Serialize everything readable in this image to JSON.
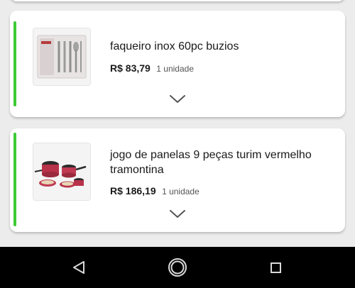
{
  "products": [
    {
      "title": "faqueiro inox 60pc buzios",
      "price": "R$ 83,79",
      "quantity": "1 unidade",
      "thumbnail_icon": "cutlery-set-box-image",
      "expand_icon": "chevron-down-icon"
    },
    {
      "title": "jogo de panelas 9 peças turim vermelho tramontina",
      "price": "R$ 186,19",
      "quantity": "1 unidade",
      "thumbnail_icon": "cookware-set-image",
      "expand_icon": "chevron-down-icon"
    }
  ],
  "nav_bar": {
    "back_icon": "triangle-back-icon",
    "home_icon": "circle-home-icon",
    "recents_icon": "square-recents-icon"
  },
  "colors": {
    "accent": "#3dcb35",
    "background": "#ececec",
    "card": "#ffffff",
    "nav_bar": "#000000"
  }
}
